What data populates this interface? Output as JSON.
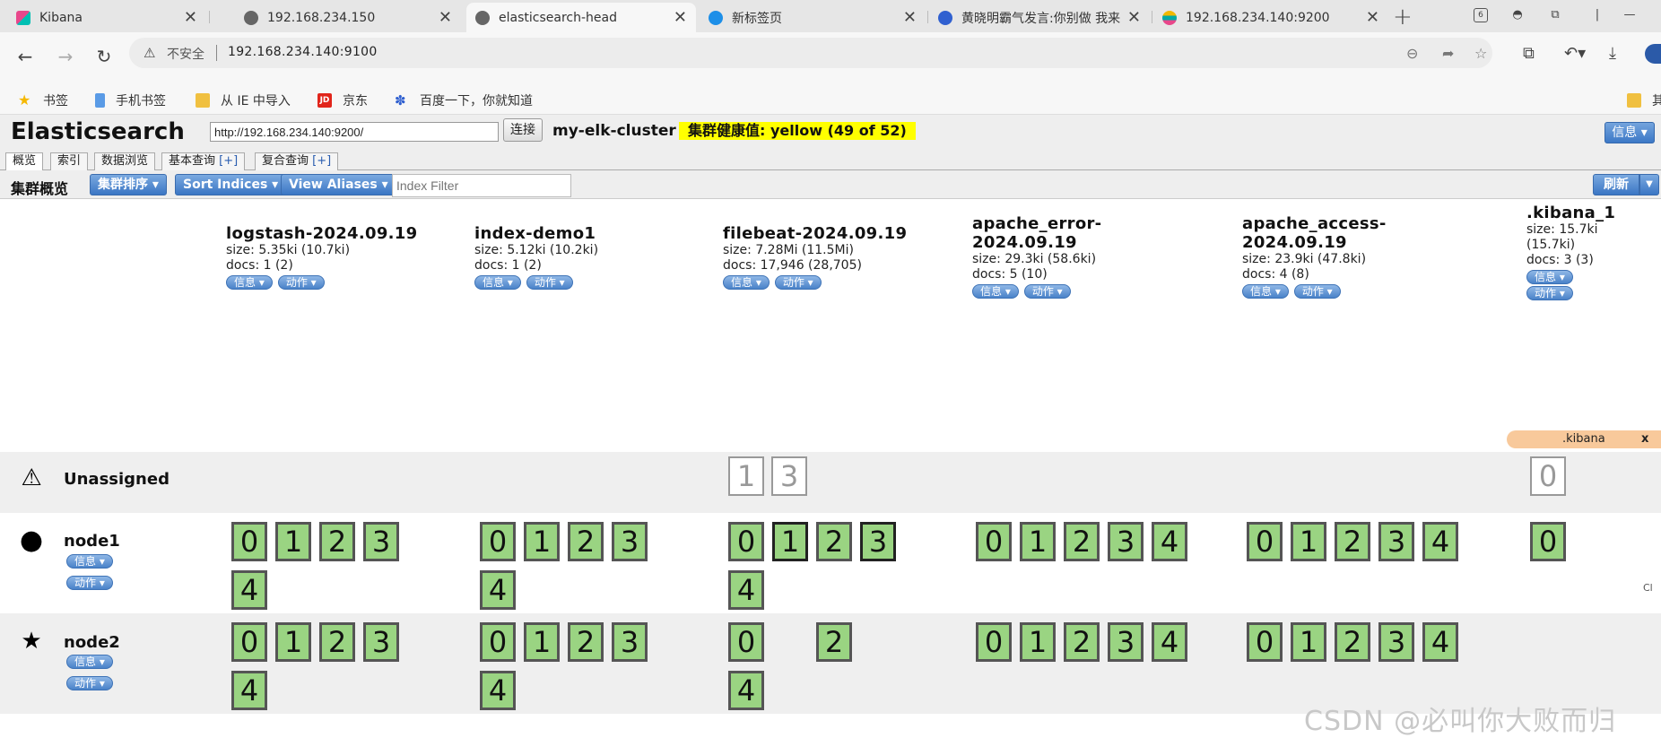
{
  "browser": {
    "tabs": [
      {
        "title": "Kibana",
        "active": false
      },
      {
        "title": "192.168.234.150",
        "active": false
      },
      {
        "title": "elasticsearch-head",
        "active": true
      },
      {
        "title": "新标签页",
        "active": false
      },
      {
        "title": "黄晓明霸气发言:你别做 我来",
        "active": false
      },
      {
        "title": "192.168.234.140:9200",
        "active": false
      }
    ],
    "address": {
      "security_label": "不安全",
      "url": "192.168.234.140:9100"
    },
    "bookmarks": [
      {
        "label": "书签",
        "icon": "star-icon",
        "color": "#f5b800"
      },
      {
        "label": "手机书签",
        "icon": "phone-icon",
        "color": "#5a9be6"
      },
      {
        "label": "从 IE 中导入",
        "icon": "folder-icon",
        "color": "#f0c040"
      },
      {
        "label": "京东",
        "icon": "jd-icon",
        "color": "#e1251b"
      },
      {
        "label": "百度一下，你就知道",
        "icon": "baidu-paw-icon",
        "color": "#3060d0"
      }
    ],
    "bookmark_overflow_label": "其"
  },
  "head": {
    "brand": "Elasticsearch",
    "connect_url": "http://192.168.234.140:9200/",
    "connect_label": "连接",
    "cluster_name": "my-elk-cluster",
    "health_text": "集群健康值: yellow (49 of 52)",
    "health_color": "#ffff00",
    "info_label": "信息",
    "tabs": [
      {
        "label": "概览",
        "active": true
      },
      {
        "label": "索引",
        "active": false
      },
      {
        "label": "数据浏览",
        "active": false
      },
      {
        "label": "基本查询",
        "plus": "[+]",
        "active": false
      },
      {
        "label": "复合查询",
        "plus": "[+]",
        "active": false
      }
    ],
    "toolbar": {
      "title": "集群概览",
      "sort_cluster_label": "集群排序",
      "sort_indices_label": "Sort Indices",
      "view_aliases_label": "View Aliases",
      "filter_placeholder": "Index Filter",
      "refresh_label": "刷新"
    },
    "pill_info": "信息 ▾",
    "pill_action": "动作 ▾",
    "indices": [
      {
        "name": "logstash-2024.09.19",
        "size": "size: 5.35ki (10.7ki)",
        "docs": "docs: 1 (2)"
      },
      {
        "name": "index-demo1",
        "size": "size: 5.12ki (10.2ki)",
        "docs": "docs: 1 (2)"
      },
      {
        "name": "filebeat-2024.09.19",
        "size": "size: 7.28Mi (11.5Mi)",
        "docs": "docs: 17,946 (28,705)"
      },
      {
        "name": "apache_error-\n2024.09.19",
        "size": "size: 29.3ki (58.6ki)",
        "docs": "docs: 5 (10)"
      },
      {
        "name": "apache_access-\n2024.09.19",
        "size": "size: 23.9ki (47.8ki)",
        "docs": "docs: 4 (8)"
      },
      {
        "name": ".kibana_1",
        "size": "size: 15.7ki\n(15.7ki)",
        "docs": "docs: 3 (3)"
      }
    ],
    "kibana_tooltip": {
      "label": ".kibana",
      "close": "x"
    },
    "rows": {
      "unassigned": {
        "label": "Unassigned",
        "icon": "warning-icon"
      },
      "node1": {
        "label": "node1",
        "icon": "circle-icon"
      },
      "node2": {
        "label": "node2",
        "icon": "star-master-icon"
      }
    },
    "shards": {
      "unassigned": [
        [],
        [],
        [
          "1",
          "3"
        ],
        [],
        [],
        [
          "0"
        ]
      ],
      "node1": [
        [
          "0",
          "1",
          "2",
          "3",
          "4"
        ],
        [
          "0",
          "1",
          "2",
          "3",
          "4"
        ],
        [
          "0",
          "1",
          "2",
          "3",
          "4"
        ],
        [
          "0",
          "1",
          "2",
          "3",
          "4"
        ],
        [
          "0",
          "1",
          "2",
          "3",
          "4"
        ],
        [
          "0"
        ]
      ],
      "node2": [
        [
          "0",
          "1",
          "2",
          "3",
          "4"
        ],
        [
          "0",
          "1",
          "2",
          "3",
          "4"
        ],
        [
          "0",
          "",
          "2",
          "",
          "4"
        ],
        [
          "0",
          "1",
          "2",
          "3",
          "4"
        ],
        [
          "0",
          "1",
          "2",
          "3",
          "4"
        ],
        []
      ]
    },
    "side_marker": "Cl",
    "watermark": "CSDN @必叫你大败而归",
    "colors": {
      "shard_green": "#9ad482",
      "button_blue": "#3b76c4",
      "tooltip_orange": "#f8c99b"
    }
  }
}
